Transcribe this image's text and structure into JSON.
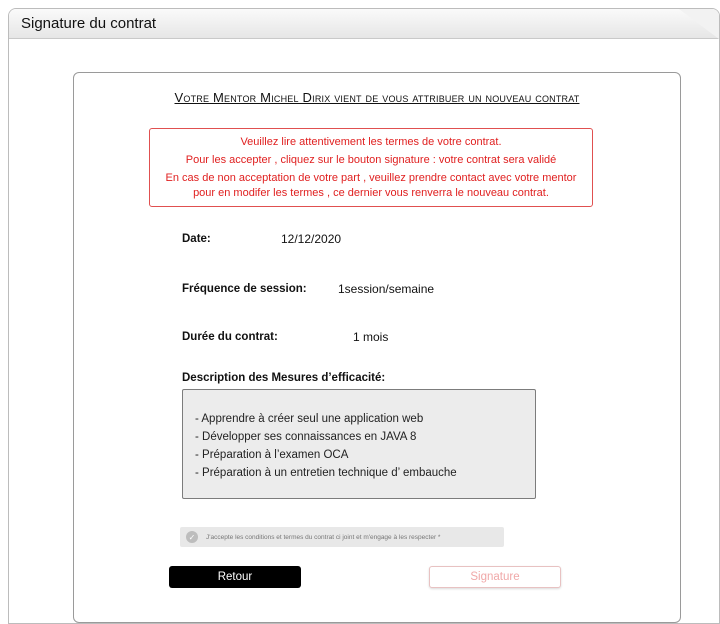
{
  "window": {
    "title": "Signature du contrat"
  },
  "contract": {
    "heading": "Votre Mentor Michel Dirix vient de vous attribuer un nouveau contrat",
    "warning": {
      "line1": "Veuillez lire attentivement les termes de votre contrat.",
      "line2": "Pour les accepter , cliquez sur le bouton signature : votre contrat sera validé",
      "line3": "En cas de non acceptation de votre part , veuillez prendre contact avec votre mentor",
      "line4": "pour en modifer les termes , ce dernier vous renverra le nouveau contrat."
    },
    "date_label": "Date:",
    "date_value": "12/12/2020",
    "frequency_label": "Fréquence de session:",
    "frequency_value": "1session/semaine",
    "duration_label": "Durée du contrat:",
    "duration_value": "1 mois",
    "description_label": "Description des Mesures d’efficacité:",
    "description_items": [
      "- Apprendre à créer seul une application web",
      "- Développer ses connaissances en JAVA 8",
      "- Préparation à l’examen OCA",
      "- Préparation à un entretien technique d’ embauche"
    ],
    "accept_text": "J'accepte les conditions et termes du contrat ci joint et m'engage à les respecter *",
    "back_button": "Retour",
    "sign_button": "Signature"
  },
  "colors": {
    "warning": "#e02020",
    "back_button_bg": "#000000",
    "sign_button_text": "#f0a8a8"
  },
  "icons": {
    "accept_checkbox": "check-circle-icon"
  }
}
